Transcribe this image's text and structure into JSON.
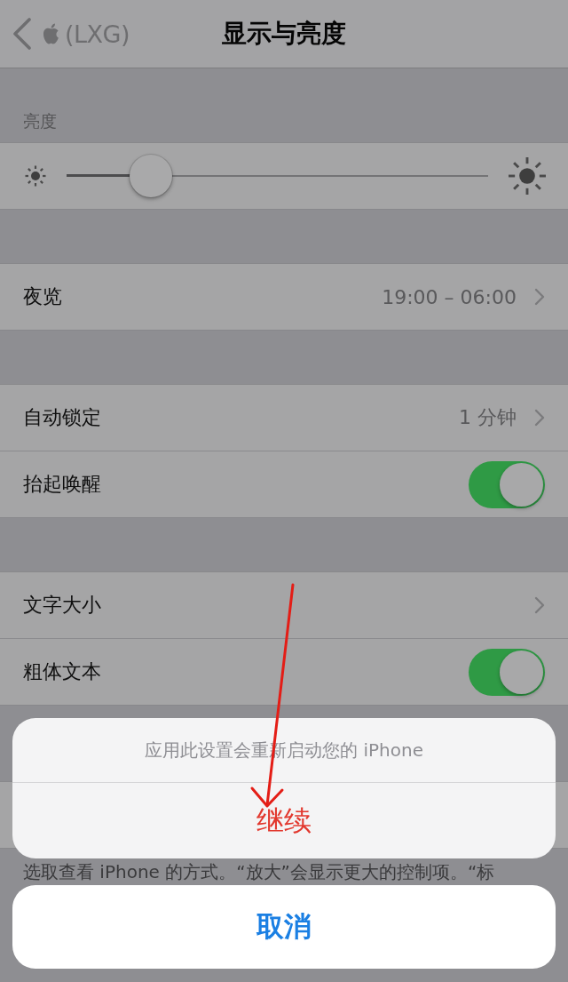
{
  "nav": {
    "back_label": "(LXG)",
    "title": "显示与亮度"
  },
  "sections": [
    {
      "header": "亮度",
      "rows": [
        {
          "kind": "slider",
          "level": 0.2
        }
      ]
    },
    {
      "rows": [
        {
          "kind": "link",
          "label": "夜览",
          "value": "19:00 – 06:00"
        }
      ]
    },
    {
      "rows": [
        {
          "kind": "link",
          "label": "自动锁定",
          "value": "1 分钟"
        },
        {
          "kind": "toggle",
          "label": "抬起唤醒",
          "on": true
        }
      ]
    },
    {
      "rows": [
        {
          "kind": "link",
          "label": "文字大小"
        },
        {
          "kind": "toggle",
          "label": "粗体文本",
          "on": true
        }
      ]
    },
    {
      "rows": [
        {
          "kind": "blank"
        }
      ],
      "footer": "选取查看 iPhone 的方式。“放大”会显示更大的控制项。“标"
    }
  ],
  "action_sheet": {
    "message": "应用此设置会重新启动您的 iPhone",
    "actions": [
      {
        "kind": "destructive",
        "label": "继续"
      }
    ],
    "cancel": "取消"
  }
}
